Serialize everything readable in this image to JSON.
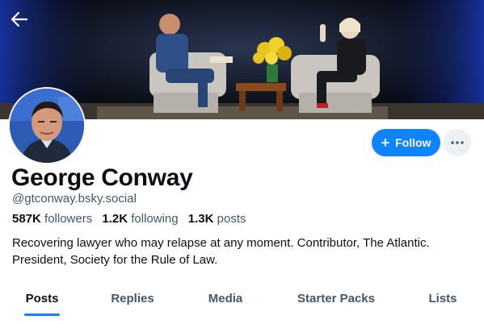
{
  "header": {
    "back_icon": "arrow-left-icon"
  },
  "profile": {
    "display_name": "George Conway",
    "handle": "@gtconway.bsky.social",
    "followers_count": "587K",
    "followers_label": "followers",
    "following_count": "1.2K",
    "following_label": "following",
    "posts_count": "1.3K",
    "posts_label": "posts",
    "bio_line1": "Recovering lawyer who may relapse at any moment. Contributor, The Atlantic.",
    "bio_line2": "President, Society for the Rule of Law."
  },
  "actions": {
    "follow_label": "Follow",
    "follow_icon": "plus-icon",
    "more_icon": "ellipsis-icon"
  },
  "tabs": [
    {
      "label": "Posts",
      "active": true
    },
    {
      "label": "Replies",
      "active": false
    },
    {
      "label": "Media",
      "active": false
    },
    {
      "label": "Starter Packs",
      "active": false
    },
    {
      "label": "Lists",
      "active": false
    }
  ],
  "colors": {
    "accent": "#1083fe",
    "text_primary": "#0b0f14",
    "text_secondary": "#42576c",
    "more_button_bg": "#eef1f4"
  }
}
